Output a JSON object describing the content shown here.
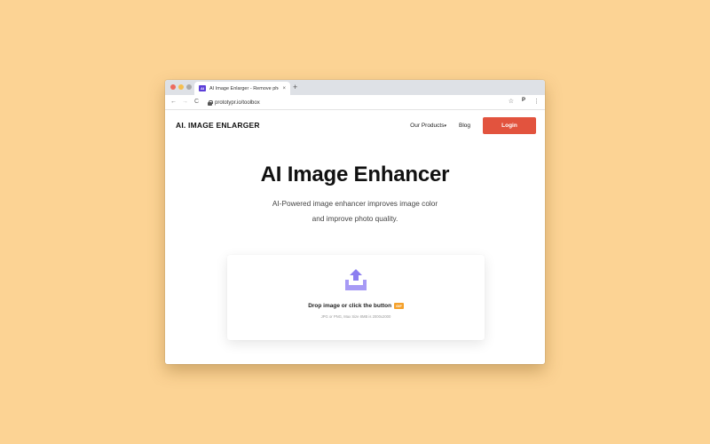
{
  "browser": {
    "tab_title": "AI Image Enlarger - Remove photo blur",
    "tab_close": "×",
    "new_tab": "+",
    "favicon_text": "AI",
    "url": "prototypr.io/toolbox",
    "back": "←",
    "forward": "→",
    "reload": "C",
    "star": "☆",
    "extension": "P",
    "menu": "⋮"
  },
  "site": {
    "logo": "AI. IMAGE ENLARGER",
    "nav": {
      "products": "Our Products",
      "products_caret": "▾",
      "blog": "Blog",
      "login": "Login"
    }
  },
  "hero": {
    "title": "AI Image Enhancer",
    "subtitle_line1": "AI-Powered image enhancer improves image color",
    "subtitle_line2": "and improve photo quality."
  },
  "upload": {
    "drop_text": "Drop image or click the button",
    "badge": "GIF",
    "hint": "JPG or PNG, Max Size 8MB is 2000x2000"
  },
  "colors": {
    "background": "#fcd394",
    "login_button": "#e2533e",
    "upload_icon": "#8c7ef0",
    "badge": "#f5a12b"
  }
}
